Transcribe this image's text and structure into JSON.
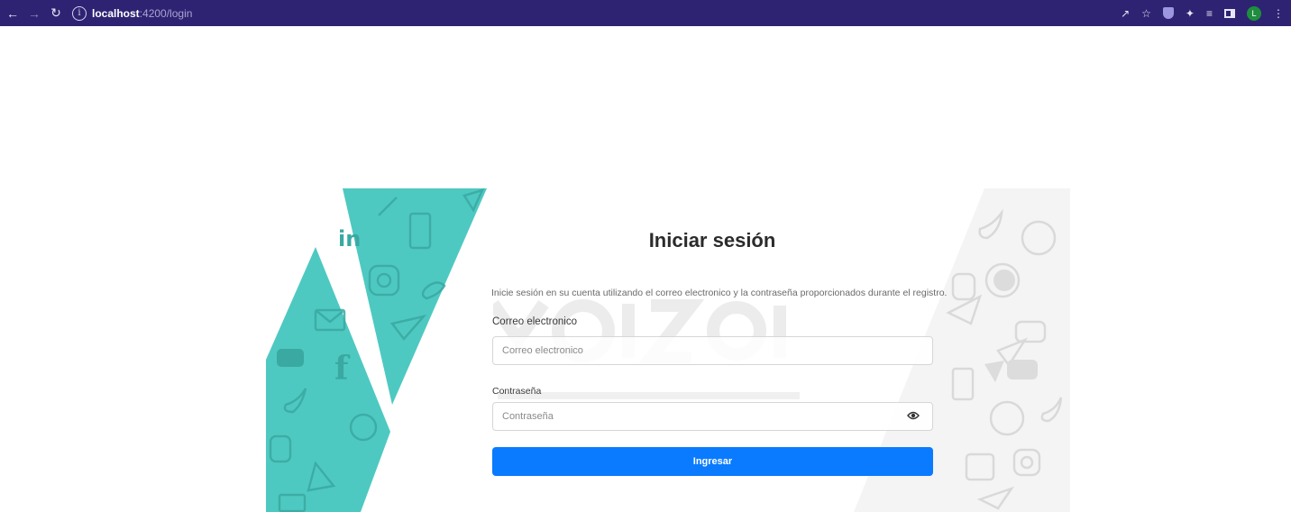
{
  "browser": {
    "url_host": "localhost",
    "url_path": ":4200/login",
    "profile_initial": "L",
    "icons": [
      "back-arrow-icon",
      "forward-arrow-icon",
      "reload-icon",
      "info-icon",
      "share-icon",
      "star-icon",
      "extension-shield-icon",
      "puzzle-icon",
      "reading-list-icon",
      "side-panel-icon",
      "kebab-menu-icon"
    ]
  },
  "login": {
    "title": "Iniciar sesión",
    "description": "Inicie sesión en su cuenta utilizando el correo electronico y la contraseña proporcionados durante el registro.",
    "email_label": "Correo electronico",
    "email_placeholder": "Correo electronico",
    "email_value": "",
    "password_label": "Contraseña",
    "password_placeholder": "Contraseña",
    "password_value": "",
    "submit_label": "Ingresar"
  },
  "colors": {
    "chrome_bg": "#2e2373",
    "accent": "#0a7bff",
    "teal": "#4ec9c1"
  }
}
